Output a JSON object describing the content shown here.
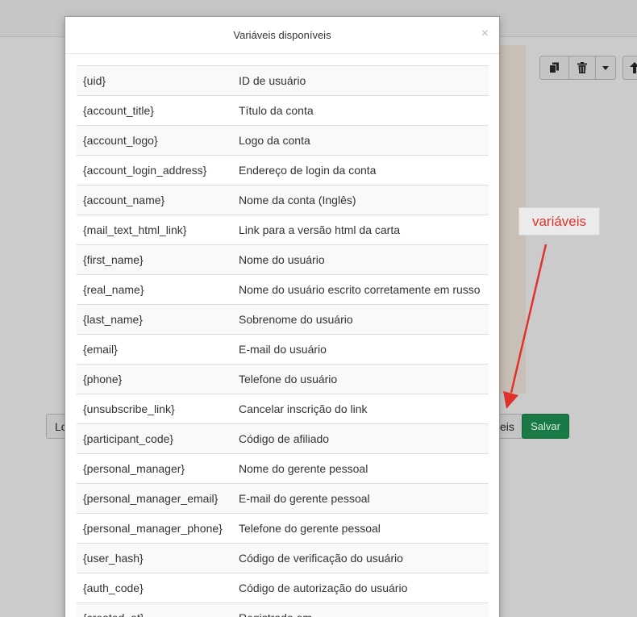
{
  "background": {
    "bottom_left_button_label": "Lo",
    "bottom_right_button_label": "eis",
    "save_label": "Salvar",
    "colors": {
      "save": "#197a45",
      "overlay": "#c9c9c9"
    }
  },
  "toolbar": {
    "icons": [
      "copy-icon",
      "trash-icon",
      "caret-down-icon",
      "arrow-up-icon"
    ]
  },
  "annotation": {
    "label": "variáveis",
    "color": "#e0322a"
  },
  "modal": {
    "title": "Variáveis disponíveis",
    "close_symbol": "×",
    "variables": [
      {
        "name": "{uid}",
        "description": "ID de usuário"
      },
      {
        "name": "{account_title}",
        "description": "Título da conta"
      },
      {
        "name": "{account_logo}",
        "description": "Logo da conta"
      },
      {
        "name": "{account_login_address}",
        "description": "Endereço de login da conta"
      },
      {
        "name": "{account_name}",
        "description": "Nome da conta (Inglês)"
      },
      {
        "name": "{mail_text_html_link}",
        "description": "Link para a versão html da carta"
      },
      {
        "name": "{first_name}",
        "description": "Nome do usuário"
      },
      {
        "name": "{real_name}",
        "description": "Nome do usuário escrito corretamente em russo"
      },
      {
        "name": "{last_name}",
        "description": "Sobrenome do usuário"
      },
      {
        "name": "{email}",
        "description": "E-mail do usuário"
      },
      {
        "name": "{phone}",
        "description": "Telefone do usuário"
      },
      {
        "name": "{unsubscribe_link}",
        "description": "Cancelar inscrição do link"
      },
      {
        "name": "{participant_code}",
        "description": "Código de afiliado"
      },
      {
        "name": "{personal_manager}",
        "description": "Nome do gerente pessoal"
      },
      {
        "name": "{personal_manager_email}",
        "description": "E-mail do gerente pessoal"
      },
      {
        "name": "{personal_manager_phone}",
        "description": "Telefone do gerente pessoal"
      },
      {
        "name": "{user_hash}",
        "description": "Código de verificação do usuário"
      },
      {
        "name": "{auth_code}",
        "description": "Código de autorização do usuário"
      },
      {
        "name": "{created_at}",
        "description": "Registrado em"
      }
    ]
  }
}
